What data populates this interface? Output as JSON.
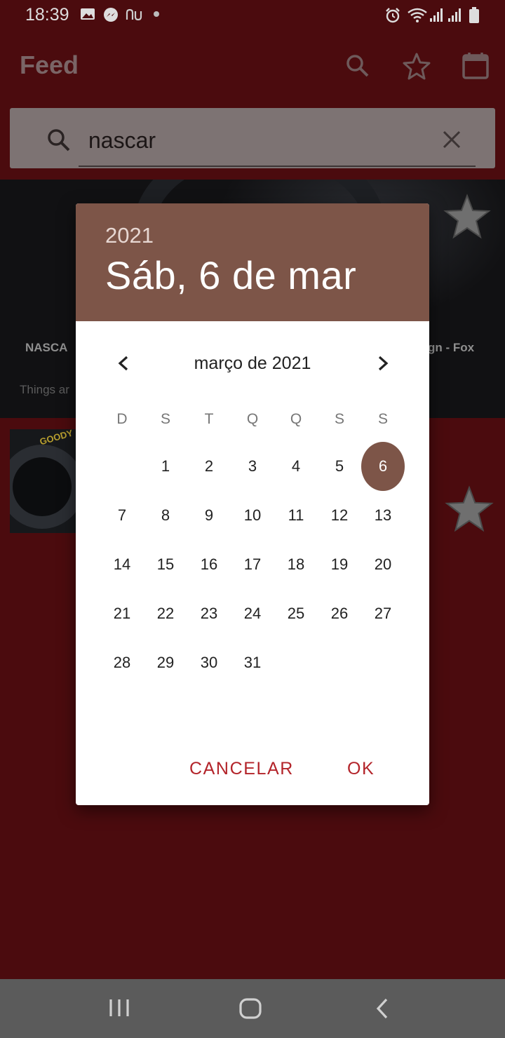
{
  "status_bar": {
    "time": "18:39"
  },
  "app_bar": {
    "title": "Feed",
    "icons": [
      "search-icon",
      "star-outline-icon",
      "calendar-icon"
    ]
  },
  "search": {
    "query": "nascar",
    "icon": "search-icon",
    "clear_icon": "close-icon"
  },
  "feed": {
    "card_title_left": "NASCA",
    "card_title_right": "gn - Fox",
    "card_snippet": "Things ar",
    "thumb_brand": "GOODY"
  },
  "date_picker": {
    "year": "2021",
    "selected_date": "Sáb, 6 de mar",
    "month_label": "março de 2021",
    "weekdays": [
      "D",
      "S",
      "T",
      "Q",
      "Q",
      "S",
      "S"
    ],
    "first_weekday_offset": 1,
    "days_in_month": 31,
    "selected_day": 6,
    "cancel_label": "CANCELAR",
    "ok_label": "OK",
    "accent_color": "#7d5548",
    "button_color": "#b3242a"
  },
  "nav_bar": {
    "icons": [
      "recents-icon",
      "home-icon",
      "back-icon"
    ]
  }
}
